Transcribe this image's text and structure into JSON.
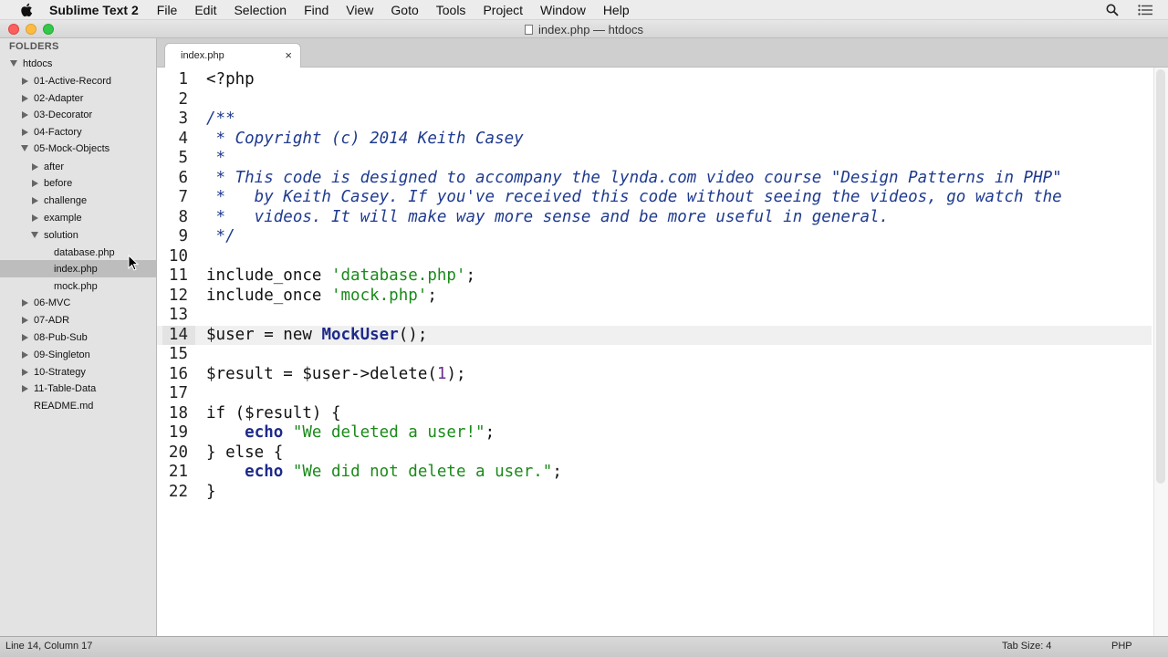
{
  "menubar": {
    "app_name": "Sublime Text 2",
    "items": [
      "File",
      "Edit",
      "Selection",
      "Find",
      "View",
      "Goto",
      "Tools",
      "Project",
      "Window",
      "Help"
    ]
  },
  "window": {
    "title": "index.php — htdocs"
  },
  "sidebar": {
    "folders_label": "FOLDERS",
    "root": "htdocs",
    "items": [
      {
        "label": "01-Active-Record"
      },
      {
        "label": "02-Adapter"
      },
      {
        "label": "03-Decorator"
      },
      {
        "label": "04-Factory"
      },
      {
        "label": "05-Mock-Objects"
      },
      {
        "label": "after"
      },
      {
        "label": "before"
      },
      {
        "label": "challenge"
      },
      {
        "label": "example"
      },
      {
        "label": "solution"
      },
      {
        "label": "database.php"
      },
      {
        "label": "index.php"
      },
      {
        "label": "mock.php"
      },
      {
        "label": "06-MVC"
      },
      {
        "label": "07-ADR"
      },
      {
        "label": "08-Pub-Sub"
      },
      {
        "label": "09-Singleton"
      },
      {
        "label": "10-Strategy"
      },
      {
        "label": "11-Table-Data"
      },
      {
        "label": "README.md"
      }
    ],
    "selected": "index.php"
  },
  "tabs": [
    {
      "label": "index.php",
      "close": "×"
    }
  ],
  "editor": {
    "lines": [
      {
        "n": "1",
        "tokens": [
          [
            "c-op",
            "<?php"
          ]
        ]
      },
      {
        "n": "2",
        "tokens": []
      },
      {
        "n": "3",
        "tokens": [
          [
            "c-comment",
            "/**"
          ]
        ]
      },
      {
        "n": "4",
        "tokens": [
          [
            "c-comment",
            " * Copyright (c) 2014 Keith Casey"
          ]
        ]
      },
      {
        "n": "5",
        "tokens": [
          [
            "c-comment",
            " *"
          ]
        ]
      },
      {
        "n": "6",
        "tokens": [
          [
            "c-comment",
            " * This code is designed to accompany the lynda.com video course \"Design Patterns in PHP\""
          ]
        ]
      },
      {
        "n": "7",
        "tokens": [
          [
            "c-comment",
            " *   by Keith Casey. If you've received this code without seeing the videos, go watch the"
          ]
        ]
      },
      {
        "n": "8",
        "tokens": [
          [
            "c-comment",
            " *   videos. It will make way more sense and be more useful in general."
          ]
        ]
      },
      {
        "n": "9",
        "tokens": [
          [
            "c-comment",
            " */"
          ]
        ]
      },
      {
        "n": "10",
        "tokens": []
      },
      {
        "n": "11",
        "tokens": [
          [
            "c-op",
            "include_once "
          ],
          [
            "c-str",
            "'database.php'"
          ],
          [
            "c-op",
            ";"
          ]
        ]
      },
      {
        "n": "12",
        "tokens": [
          [
            "c-op",
            "include_once "
          ],
          [
            "c-str",
            "'mock.php'"
          ],
          [
            "c-op",
            ";"
          ]
        ]
      },
      {
        "n": "13",
        "tokens": []
      },
      {
        "n": "14",
        "tokens": [
          [
            "c-var",
            "$user"
          ],
          [
            "c-op",
            " = new "
          ],
          [
            "c-cls",
            "MockUser"
          ],
          [
            "c-op",
            "();"
          ]
        ]
      },
      {
        "n": "15",
        "tokens": []
      },
      {
        "n": "16",
        "tokens": [
          [
            "c-var",
            "$result"
          ],
          [
            "c-op",
            " = "
          ],
          [
            "c-var",
            "$user"
          ],
          [
            "c-op",
            "->delete("
          ],
          [
            "c-num",
            "1"
          ],
          [
            "c-op",
            ");"
          ]
        ]
      },
      {
        "n": "17",
        "tokens": []
      },
      {
        "n": "18",
        "tokens": [
          [
            "c-op",
            "if ("
          ],
          [
            "c-var",
            "$result"
          ],
          [
            "c-op",
            ") {"
          ]
        ]
      },
      {
        "n": "19",
        "tokens": [
          [
            "c-op",
            "    "
          ],
          [
            "c-kw",
            "echo"
          ],
          [
            "c-op",
            " "
          ],
          [
            "c-str",
            "\"We deleted a user!\""
          ],
          [
            "c-op",
            ";"
          ]
        ]
      },
      {
        "n": "20",
        "tokens": [
          [
            "c-op",
            "} else {"
          ]
        ]
      },
      {
        "n": "21",
        "tokens": [
          [
            "c-op",
            "    "
          ],
          [
            "c-kw",
            "echo"
          ],
          [
            "c-op",
            " "
          ],
          [
            "c-str",
            "\"We did not delete a user.\""
          ],
          [
            "c-op",
            ";"
          ]
        ]
      },
      {
        "n": "22",
        "tokens": [
          [
            "c-op",
            "}"
          ]
        ]
      }
    ],
    "current_line": 14
  },
  "statusbar": {
    "position": "Line 14, Column 17",
    "tab_size": "Tab Size: 4",
    "syntax": "PHP"
  },
  "colors": {
    "comment": "#1f3b8f",
    "string": "#1a8a1a",
    "keyword": "#1d2a8a"
  }
}
